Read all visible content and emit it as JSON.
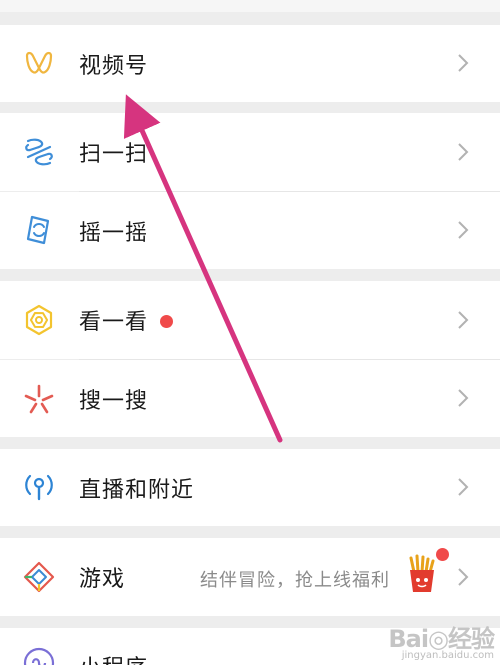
{
  "menu": {
    "items": [
      {
        "label": "视频号",
        "icon": "channels-icon"
      },
      {
        "label": "扫一扫",
        "icon": "scan-icon"
      },
      {
        "label": "摇一摇",
        "icon": "shake-icon"
      },
      {
        "label": "看一看",
        "icon": "top-stories-icon",
        "badge": "red-dot"
      },
      {
        "label": "搜一搜",
        "icon": "search-icon"
      },
      {
        "label": "直播和附近",
        "icon": "live-nearby-icon"
      },
      {
        "label": "游戏",
        "icon": "games-icon",
        "subtitle": "结伴冒险，抢上线福利"
      },
      {
        "label": "小程序",
        "icon": "mini-program-icon"
      }
    ]
  },
  "watermark": {
    "main": "Bai◎经验",
    "sub": "jingyan.baidu.com"
  },
  "colors": {
    "background": "#ededed",
    "row": "#ffffff",
    "arrow": "#d6347f",
    "badge": "#f04a4a",
    "channels": "#f0b63f",
    "scan": "#3f8ed8",
    "top_stories": "#f3c42f",
    "search": "#e35b53",
    "live": "#2d84d4",
    "games_red": "#e4584d",
    "games_blue": "#3b8ad3",
    "games_green": "#3fb56a"
  }
}
